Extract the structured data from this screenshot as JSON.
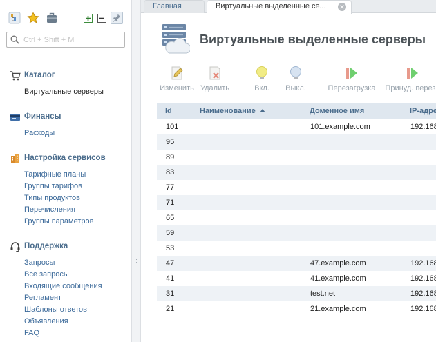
{
  "sidebar": {
    "search_placeholder": "Ctrl + Shift + M",
    "sections": [
      {
        "title": "Каталог",
        "icon": "cart-icon",
        "items": [
          {
            "label": "Виртуальные серверы",
            "active": true
          }
        ]
      },
      {
        "title": "Финансы",
        "icon": "finance-icon",
        "items": [
          {
            "label": "Расходы"
          }
        ]
      },
      {
        "title": "Настройка сервисов",
        "icon": "building-icon",
        "items": [
          {
            "label": "Тарифные планы"
          },
          {
            "label": "Группы тарифов"
          },
          {
            "label": "Типы продуктов"
          },
          {
            "label": "Перечисления"
          },
          {
            "label": "Группы параметров"
          }
        ]
      },
      {
        "title": "Поддержка",
        "icon": "headset-icon",
        "items": [
          {
            "label": "Запросы"
          },
          {
            "label": "Все запросы"
          },
          {
            "label": "Входящие сообщения"
          },
          {
            "label": "Регламент"
          },
          {
            "label": "Шаблоны ответов"
          },
          {
            "label": "Объявления"
          },
          {
            "label": "FAQ"
          }
        ]
      }
    ]
  },
  "tabs": [
    {
      "label": "Главная"
    },
    {
      "label": "Виртуальные выделенные се..."
    }
  ],
  "page": {
    "title": "Виртуальные выделенные серверы"
  },
  "toolbar": {
    "edit": "Изменить",
    "delete": "Удалить",
    "on": "Вкл.",
    "off": "Выкл.",
    "reboot": "Перезагрузка",
    "force": "Принуд. переза"
  },
  "table": {
    "columns": {
      "id": "Id",
      "name": "Наименование",
      "domain": "Доменное имя",
      "ip": "IP-адре"
    },
    "rows": [
      {
        "id": "101",
        "name": "",
        "domain": "101.example.com",
        "ip": "192.168"
      },
      {
        "id": "95",
        "name": "",
        "domain": "",
        "ip": ""
      },
      {
        "id": "89",
        "name": "",
        "domain": "",
        "ip": ""
      },
      {
        "id": "83",
        "name": "",
        "domain": "",
        "ip": ""
      },
      {
        "id": "77",
        "name": "",
        "domain": "",
        "ip": ""
      },
      {
        "id": "71",
        "name": "",
        "domain": "",
        "ip": ""
      },
      {
        "id": "65",
        "name": "",
        "domain": "",
        "ip": ""
      },
      {
        "id": "59",
        "name": "",
        "domain": "",
        "ip": ""
      },
      {
        "id": "53",
        "name": "",
        "domain": "",
        "ip": ""
      },
      {
        "id": "47",
        "name": "",
        "domain": "47.example.com",
        "ip": "192.168"
      },
      {
        "id": "41",
        "name": "",
        "domain": "41.example.com",
        "ip": "192.168"
      },
      {
        "id": "31",
        "name": "",
        "domain": "test.net",
        "ip": "192.168"
      },
      {
        "id": "21",
        "name": "",
        "domain": "21.example.com",
        "ip": "192.168"
      }
    ]
  }
}
